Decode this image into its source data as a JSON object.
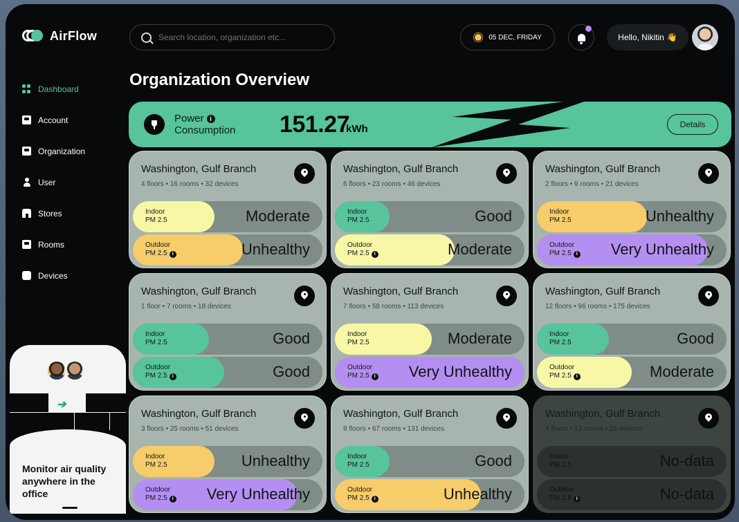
{
  "brand": {
    "name": "AirFlow"
  },
  "search": {
    "placeholder": "Search location, organization etc..."
  },
  "date": {
    "label": "05 DEC, FRIDAY",
    "icon": "sun-icon"
  },
  "notifications": {
    "icon": "bell-icon",
    "has_unread": true
  },
  "greeting": {
    "text": "Hello, Nikitin",
    "emoji": "👋"
  },
  "sidebar": {
    "items": [
      {
        "label": "Dashboard",
        "icon": "dashboard-grid-icon",
        "active": true
      },
      {
        "label": "Account",
        "icon": "account-icon",
        "active": false
      },
      {
        "label": "Organization",
        "icon": "organization-icon",
        "active": false
      },
      {
        "label": "User",
        "icon": "user-icon",
        "active": false
      },
      {
        "label": "Stores",
        "icon": "store-icon",
        "active": false
      },
      {
        "label": "Rooms",
        "icon": "room-icon",
        "active": false
      },
      {
        "label": "Devices",
        "icon": "device-icon",
        "active": false
      }
    ]
  },
  "promo": {
    "text": "Monitor air quality anywhere in the office"
  },
  "page": {
    "title": "Organization Overview"
  },
  "power": {
    "label_line1": "Power",
    "label_line2": "Consumption",
    "value": "151.27",
    "unit": "kWh",
    "details_label": "Details"
  },
  "colors": {
    "accent": "#57c49b",
    "good": "#57c49b",
    "moderate": "#f8f7a6",
    "unhealthy": "#f7cc6b",
    "very_unhealthy": "#b48ff1"
  },
  "cards": [
    {
      "title": "Washington, Gulf Branch",
      "meta": "4 floors  •  16 rooms  •  32 devices",
      "indoor": {
        "label1": "Indoor",
        "label2": "PM 2.5",
        "status": "Moderate",
        "color": "#f8f7a6",
        "level": 0.43
      },
      "outdoor": {
        "label1": "Outdoor",
        "label2": "PM 2.5",
        "status": "Unhealthy",
        "color": "#f7cc6b",
        "level": 0.58
      }
    },
    {
      "title": "Washington, Gulf Branch",
      "meta": "6 floors  •  23 rooms  •  46 devices",
      "indoor": {
        "label1": "Indoor",
        "label2": "PM 2.5",
        "status": "Good",
        "color": "#57c49b",
        "level": 0.29
      },
      "outdoor": {
        "label1": "Outdoor",
        "label2": "PM 2.5",
        "status": "Moderate",
        "color": "#f8f7a6",
        "level": 0.63
      }
    },
    {
      "title": "Washington, Gulf Branch",
      "meta": "2 floors  •  9 rooms  •  21 devices",
      "indoor": {
        "label1": "Indoor",
        "label2": "PM 2.5",
        "status": "Unhealthy",
        "color": "#f7cc6b",
        "level": 0.58
      },
      "outdoor": {
        "label1": "Outdoor",
        "label2": "PM 2.5",
        "status": "Very Unhealthy",
        "color": "#b48ff1",
        "level": 0.9
      }
    },
    {
      "title": "Washington, Gulf Branch",
      "meta": "1 floor  •  7 rooms  •  18 devices",
      "indoor": {
        "label1": "Indoor",
        "label2": "PM 2.5",
        "status": "Good",
        "color": "#57c49b",
        "level": 0.4
      },
      "outdoor": {
        "label1": "Outdoor",
        "label2": "PM 2.5",
        "status": "Good",
        "color": "#57c49b",
        "level": 0.48
      }
    },
    {
      "title": "Washington, Gulf Branch",
      "meta": "7 floors  •  58 rooms  •  113 devices",
      "indoor": {
        "label1": "Indoor",
        "label2": "PM 2.5",
        "status": "Moderate",
        "color": "#f8f7a6",
        "level": 0.51
      },
      "outdoor": {
        "label1": "Outdoor",
        "label2": "PM 2.5",
        "status": "Very Unhealthy",
        "color": "#b48ff1",
        "level": 1.0
      }
    },
    {
      "title": "Washington, Gulf Branch",
      "meta": "12 floors  •  96 rooms  •  175 devices",
      "indoor": {
        "label1": "Indoor",
        "label2": "PM 2.5",
        "status": "Good",
        "color": "#57c49b",
        "level": 0.38
      },
      "outdoor": {
        "label1": "Outdoor",
        "label2": "PM 2.5",
        "status": "Moderate",
        "color": "#f8f7a6",
        "level": 0.5
      }
    },
    {
      "title": "Washington, Gulf Branch",
      "meta": "3 floors  •  25 rooms  •  51 devices",
      "indoor": {
        "label1": "Indoor",
        "label2": "PM 2.5",
        "status": "Unhealthy",
        "color": "#f7cc6b",
        "level": 0.43
      },
      "outdoor": {
        "label1": "Outdoor",
        "label2": "PM 2.5",
        "status": "Very Unhealthy",
        "color": "#b48ff1",
        "level": 0.87
      }
    },
    {
      "title": "Washington, Gulf Branch",
      "meta": "8 floors  •  67 rooms  •  131 devices",
      "indoor": {
        "label1": "Indoor",
        "label2": "PM 2.5",
        "status": "Good",
        "color": "#57c49b",
        "level": 0.29
      },
      "outdoor": {
        "label1": "Outdoor",
        "label2": "PM 2.5",
        "status": "Unhealthy",
        "color": "#f7cc6b",
        "level": 0.77
      }
    },
    {
      "title": "Washington, Gulf Branch",
      "meta": "4 floors  •  13 rooms  •  29 devices",
      "dim": true,
      "indoor": {
        "label1": "Indoor",
        "label2": "PM 2.5",
        "status": "No-data",
        "color": "",
        "level": 0
      },
      "outdoor": {
        "label1": "Outdoor",
        "label2": "PM 2.5",
        "status": "No-data",
        "color": "",
        "level": 0
      }
    }
  ]
}
